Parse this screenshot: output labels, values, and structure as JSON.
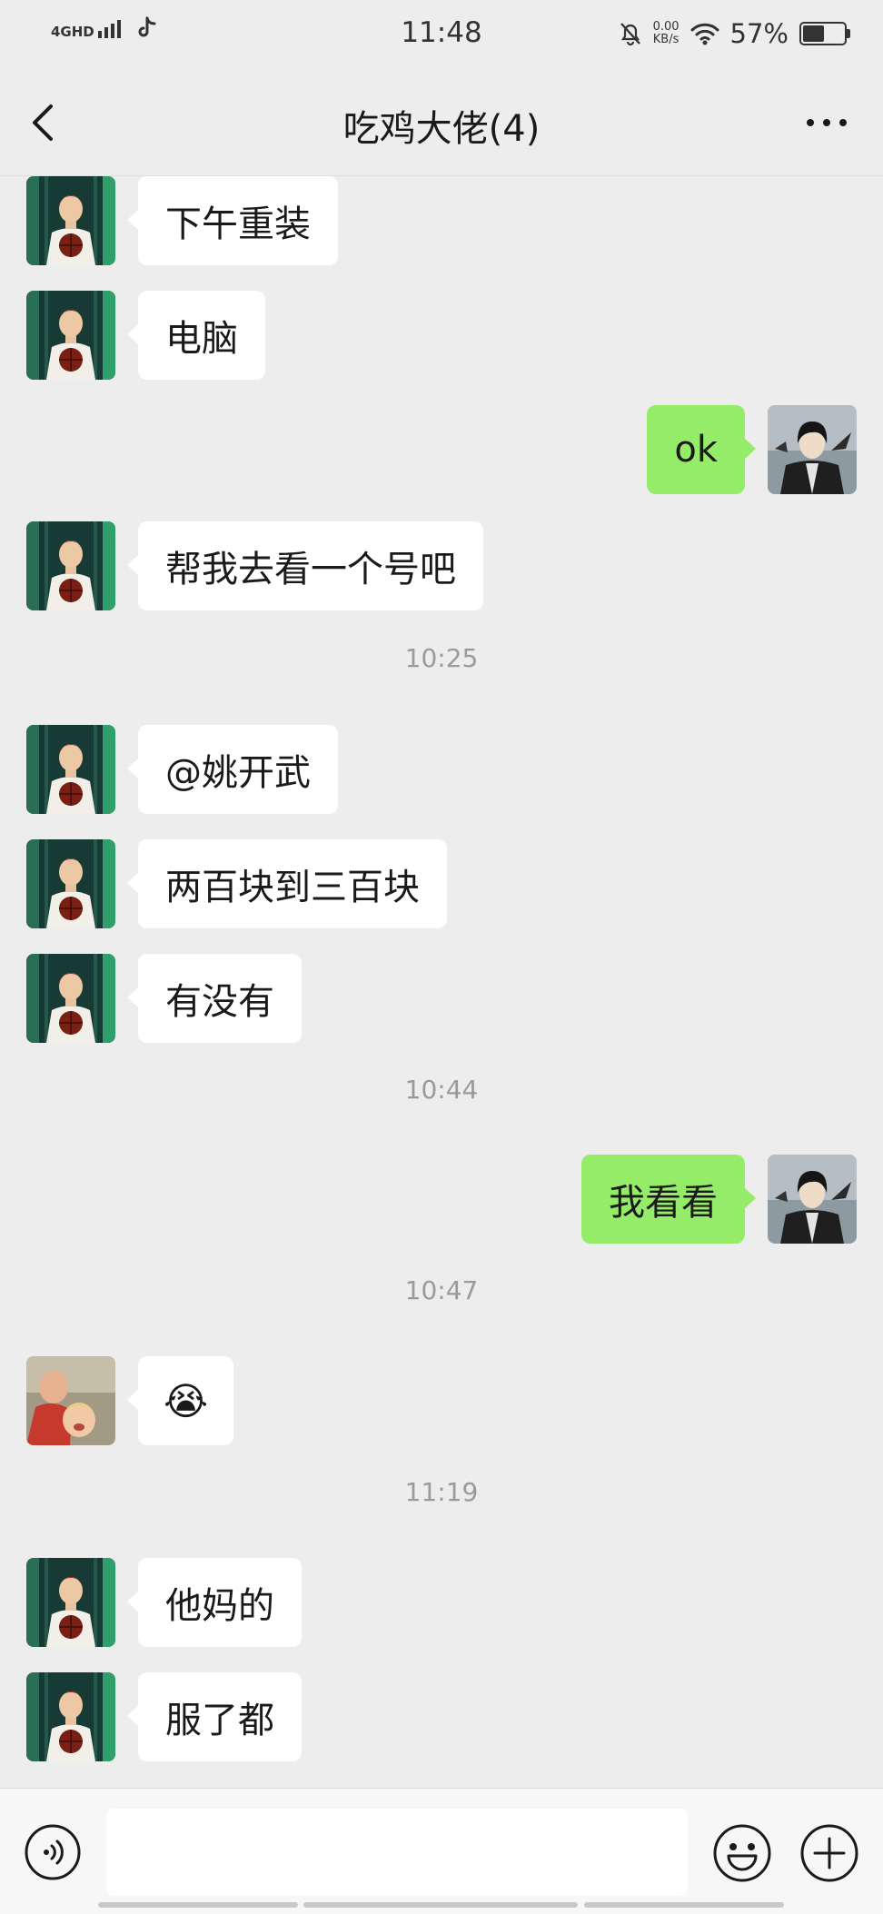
{
  "status_bar": {
    "network": "4GHD",
    "time": "11:48",
    "speed_value": "0.00",
    "speed_unit": "KB/s",
    "battery_percent": "57%",
    "battery_level": 0.57
  },
  "header": {
    "title": "吃鸡大佬(4)"
  },
  "avatars": {
    "friend_a": "basketball-player-avatar",
    "friend_b": "kids-photo-avatar",
    "me": "dark-hair-anime-avatar"
  },
  "messages": [
    {
      "type": "msg",
      "side": "in",
      "avatar": "friend_a",
      "text": "下午重装"
    },
    {
      "type": "msg",
      "side": "in",
      "avatar": "friend_a",
      "text": "电脑"
    },
    {
      "type": "msg",
      "side": "out",
      "avatar": "me",
      "text": "ok"
    },
    {
      "type": "msg",
      "side": "in",
      "avatar": "friend_a",
      "text": "帮我去看一个号吧"
    },
    {
      "type": "time",
      "text": "10:25"
    },
    {
      "type": "msg",
      "side": "in",
      "avatar": "friend_a",
      "text": "@姚开武"
    },
    {
      "type": "msg",
      "side": "in",
      "avatar": "friend_a",
      "text": "两百块到三百块"
    },
    {
      "type": "msg",
      "side": "in",
      "avatar": "friend_a",
      "text": "有没有"
    },
    {
      "type": "time",
      "text": "10:44"
    },
    {
      "type": "msg",
      "side": "out",
      "avatar": "me",
      "text": "我看看"
    },
    {
      "type": "time",
      "text": "10:47"
    },
    {
      "type": "msg",
      "side": "in",
      "avatar": "friend_b",
      "text": "😭",
      "emoji": true
    },
    {
      "type": "time",
      "text": "11:19"
    },
    {
      "type": "msg",
      "side": "in",
      "avatar": "friend_a",
      "text": "他妈的"
    },
    {
      "type": "msg",
      "side": "in",
      "avatar": "friend_a",
      "text": "服了都"
    }
  ],
  "input": {
    "value": "",
    "placeholder": ""
  },
  "icons": {
    "voice": "voice-icon",
    "emoji": "emoji-icon",
    "plus": "plus-icon",
    "back": "back-arrow-icon",
    "more": "more-icon"
  },
  "colors": {
    "background": "#ededed",
    "incoming_bubble": "#ffffff",
    "outgoing_bubble": "#95ec69",
    "timestamp": "#9a9a9a"
  }
}
